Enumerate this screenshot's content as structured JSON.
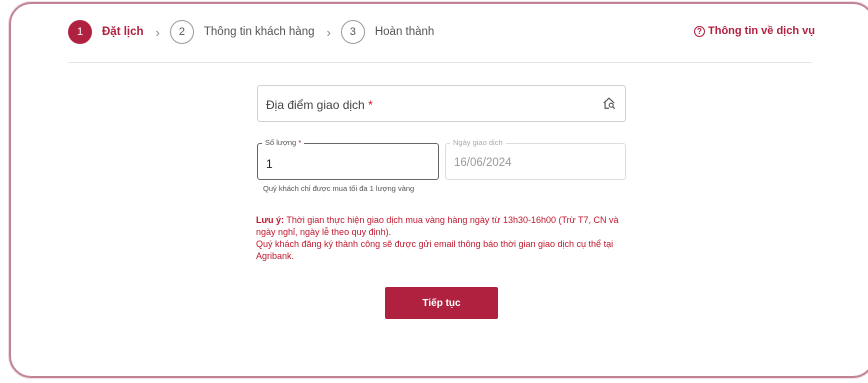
{
  "stepper": {
    "steps": [
      {
        "number": "1",
        "label": "Đặt lịch"
      },
      {
        "number": "2",
        "label": "Thông tin khách hàng"
      },
      {
        "number": "3",
        "label": "Hoàn thành"
      }
    ],
    "chevron": "›"
  },
  "header": {
    "info_link": "Thông tin về dịch vụ",
    "info_icon_glyph": "?"
  },
  "form": {
    "location": {
      "label": "Địa điểm giao dịch",
      "required_mark": "*",
      "icon": "home-search-icon"
    },
    "quantity": {
      "label": "Số lượng",
      "required_mark": "*",
      "value": "1",
      "helper": "Quý khách chỉ được mua tối đa 1 lượng vàng"
    },
    "date": {
      "label": "Ngày giao dịch",
      "value": "16/06/2024"
    }
  },
  "notes": {
    "prefix": "Lưu ý:",
    "line1": " Thời gian thực hiện giao dịch mua vàng hàng ngày từ 13h30-16h00 (Trừ T7, CN và ngày nghỉ, ngày lễ theo quy định).",
    "line2": "Quý khách đăng ký thành công sẽ được gửi email thông báo thời gian giao dịch cụ thể tại Agribank."
  },
  "actions": {
    "continue_label": "Tiếp tục"
  },
  "colors": {
    "primary": "#b0213f",
    "required": "#c0182e",
    "border": "#c08595"
  }
}
